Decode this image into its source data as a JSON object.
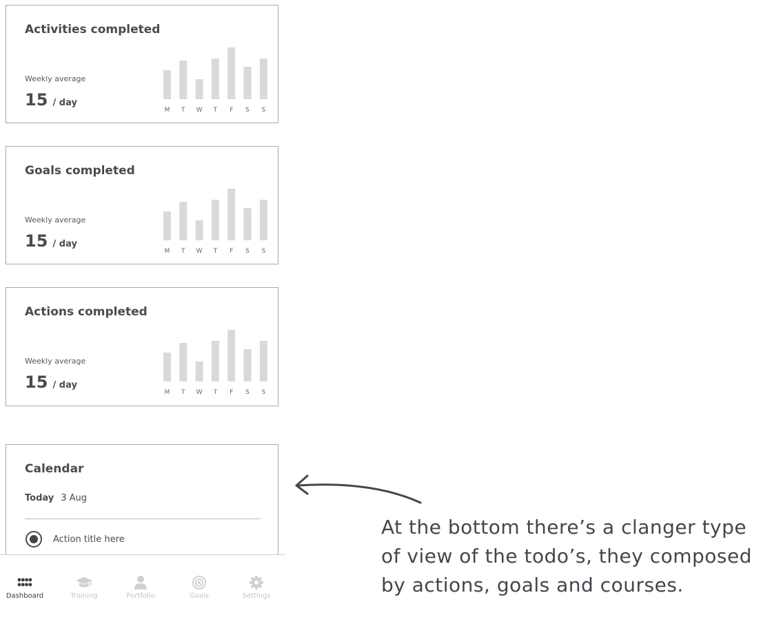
{
  "cards": [
    {
      "title": "Activities completed",
      "subtitle": "Weekly average",
      "value": "15",
      "unit": "/ day",
      "chart_data": {
        "type": "bar",
        "categories": [
          "M",
          "T",
          "W",
          "T",
          "F",
          "S",
          "S"
        ],
        "values": [
          42,
          56,
          29,
          59,
          75,
          47,
          59
        ],
        "ylim": [
          0,
          80
        ]
      }
    },
    {
      "title": "Goals completed",
      "subtitle": "Weekly average",
      "value": "15",
      "unit": "/ day",
      "chart_data": {
        "type": "bar",
        "categories": [
          "M",
          "T",
          "W",
          "T",
          "F",
          "S",
          "S"
        ],
        "values": [
          42,
          56,
          29,
          59,
          75,
          47,
          59
        ],
        "ylim": [
          0,
          80
        ]
      }
    },
    {
      "title": "Actions completed",
      "subtitle": "Weekly average",
      "value": "15",
      "unit": "/ day",
      "chart_data": {
        "type": "bar",
        "categories": [
          "M",
          "T",
          "W",
          "T",
          "F",
          "S",
          "S"
        ],
        "values": [
          42,
          56,
          29,
          59,
          75,
          47,
          59
        ],
        "ylim": [
          0,
          80
        ]
      }
    }
  ],
  "calendar": {
    "title": "Calendar",
    "today_label": "Today",
    "date": "3 Aug",
    "action_label": "Action title here"
  },
  "nav": {
    "items": [
      {
        "label": "Dashboard",
        "icon": "dashboard-grid-icon",
        "active": true
      },
      {
        "label": "Training",
        "icon": "graduation-cap-icon",
        "active": false
      },
      {
        "label": "Portfolio",
        "icon": "person-icon",
        "active": false
      },
      {
        "label": "Goals",
        "icon": "target-icon",
        "active": false
      },
      {
        "label": "Settings",
        "icon": "gear-icon",
        "active": false
      }
    ]
  },
  "annotation": {
    "text": "At the bottom there’s a clanger type of view of the todo’s, they composed by actions, goals and courses."
  },
  "colors": {
    "bar": "#d9d9d9",
    "text": "#4a4a52",
    "nav_inactive": "#c4c4c4",
    "nav_active": "#3b3b44"
  }
}
